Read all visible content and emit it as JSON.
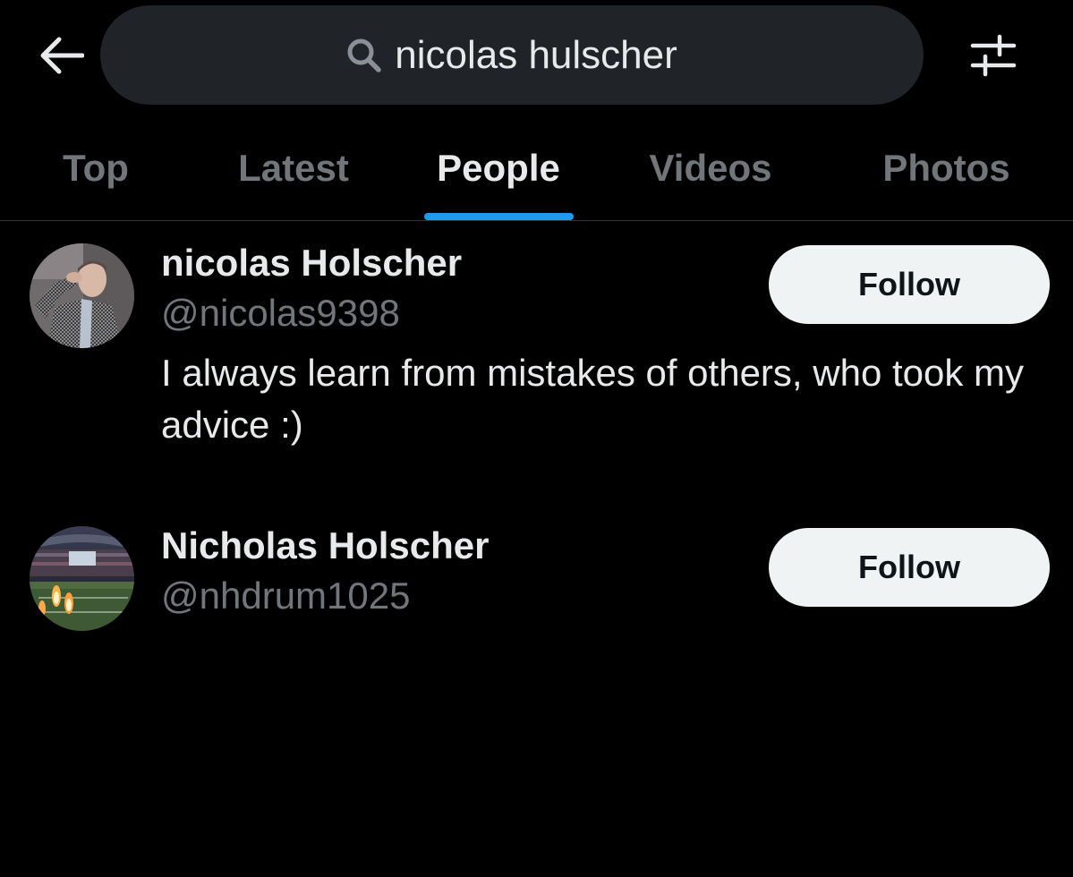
{
  "search": {
    "query": "nicolas hulscher",
    "back_icon": "arrow-left-icon",
    "search_icon": "magnifier-icon",
    "filter_icon": "sliders-icon"
  },
  "tabs": [
    {
      "label": "Top",
      "active": false
    },
    {
      "label": "Latest",
      "active": false
    },
    {
      "label": "People",
      "active": true
    },
    {
      "label": "Videos",
      "active": false
    },
    {
      "label": "Photos",
      "active": false
    }
  ],
  "results": [
    {
      "name": "nicolas Holscher",
      "handle": "@nicolas9398",
      "bio": "I always learn from mistakes of others, who took my advice :)",
      "follow_label": "Follow"
    },
    {
      "name": "Nicholas Holscher",
      "handle": "@nhdrum1025",
      "bio": "",
      "follow_label": "Follow"
    }
  ],
  "colors": {
    "background": "#000000",
    "search_bg": "#202327",
    "primary_text": "#e7e9ea",
    "secondary_text": "#71767b",
    "accent": "#1d9bf0",
    "follow_bg": "#eff3f4",
    "follow_text": "#0f1419"
  }
}
